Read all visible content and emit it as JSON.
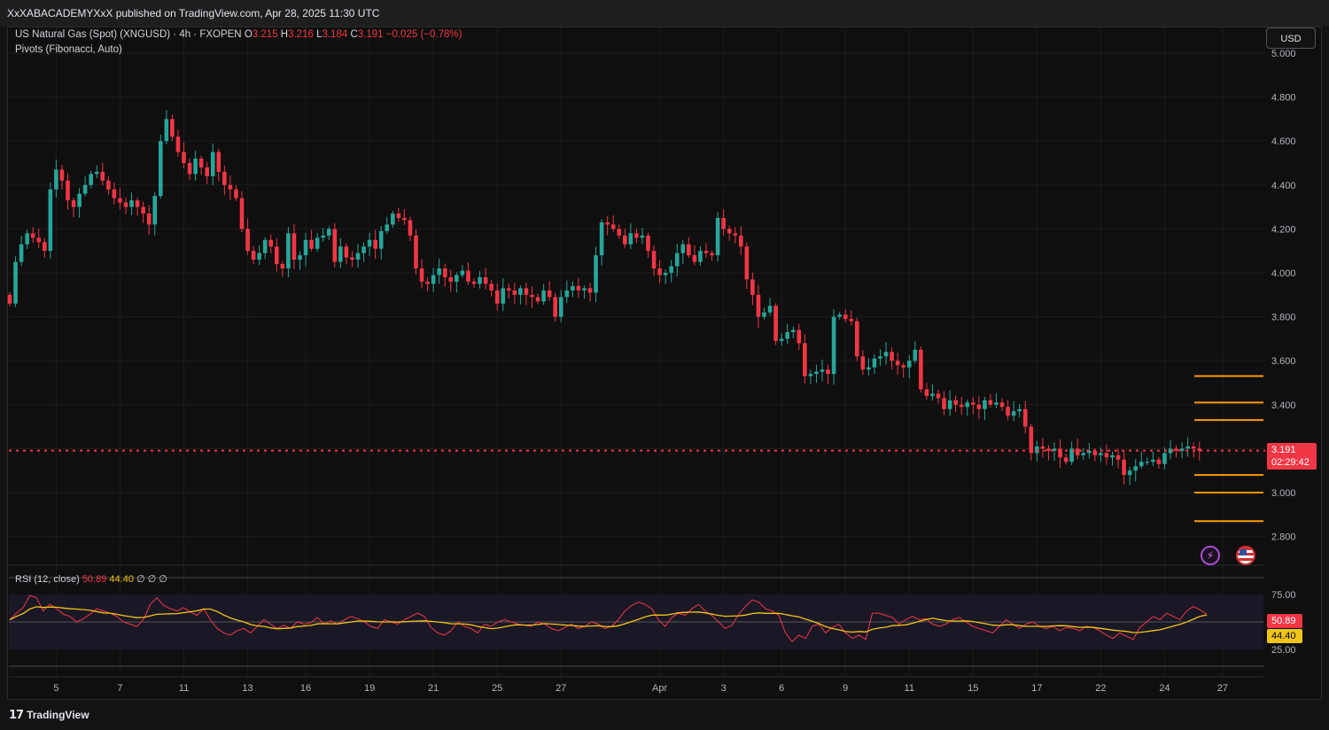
{
  "header": {
    "publisher_line": "XxXABACADEMYXxX published on TradingView.com, Apr 28, 2025 11:30 UTC"
  },
  "legend": {
    "symbol": "US Natural Gas (Spot) (XNGUSD) · 4h · FXOPEN",
    "open_label": "O",
    "open": "3.215",
    "high_label": "H",
    "high": "3.216",
    "low_label": "L",
    "low": "3.184",
    "close_label": "C",
    "close": "3.191",
    "change": "−0.025 (−0.78%)",
    "indicator": "Pivots (Fibonacci, Auto)"
  },
  "currency_button": "USD",
  "price_tag": {
    "price": "3.191",
    "countdown": "02:29:42"
  },
  "rsi": {
    "label": "RSI (12, close)",
    "value": "50.89",
    "ma_value": "44.40",
    "extras": "∅ ∅ ∅",
    "levels": [
      "75.00",
      "25.00"
    ]
  },
  "footer": {
    "brand": "TradingView"
  },
  "icons": {
    "bolt": "lightning-icon",
    "flag": "us-flag-icon",
    "logo": "tradingview-logo-icon"
  },
  "colors": {
    "up": "#26a69a",
    "down": "#f23645",
    "pivot": "#ff9800",
    "rsi": "#f23645",
    "rsi_ma": "#f0c419",
    "background": "#0f0f0f"
  },
  "chart_data": {
    "type": "candlestick",
    "symbol": "XNGUSD",
    "timeframe": "4h",
    "y_ticks": [
      "5.000",
      "4.800",
      "4.600",
      "4.400",
      "4.200",
      "4.000",
      "3.800",
      "3.600",
      "3.400",
      "3.200",
      "3.000",
      "2.800"
    ],
    "ylim": [
      2.72,
      5.02
    ],
    "x_labels": [
      {
        "label": "5",
        "i": 8
      },
      {
        "label": "7",
        "i": 19
      },
      {
        "label": "11",
        "i": 30
      },
      {
        "label": "13",
        "i": 41
      },
      {
        "label": "16",
        "i": 51
      },
      {
        "label": "19",
        "i": 62
      },
      {
        "label": "21",
        "i": 73
      },
      {
        "label": "25",
        "i": 84
      },
      {
        "label": "27",
        "i": 95
      },
      {
        "label": "Apr",
        "i": 112
      },
      {
        "label": "3",
        "i": 123
      },
      {
        "label": "6",
        "i": 133
      },
      {
        "label": "9",
        "i": 144
      },
      {
        "label": "11",
        "i": 155
      },
      {
        "label": "15",
        "i": 166
      },
      {
        "label": "17",
        "i": 177
      },
      {
        "label": "22",
        "i": 188
      },
      {
        "label": "24",
        "i": 199
      },
      {
        "label": "27",
        "i": 209
      }
    ],
    "last_price": 3.191,
    "pivots": [
      3.53,
      3.41,
      3.33,
      3.08,
      3.0,
      2.87
    ],
    "closes": [
      3.86,
      4.05,
      4.13,
      4.18,
      4.16,
      4.14,
      4.1,
      4.38,
      4.47,
      4.42,
      4.33,
      4.3,
      4.36,
      4.4,
      4.45,
      4.46,
      4.42,
      4.38,
      4.34,
      4.32,
      4.3,
      4.33,
      4.3,
      4.27,
      4.22,
      4.35,
      4.6,
      4.7,
      4.62,
      4.55,
      4.5,
      4.45,
      4.52,
      4.48,
      4.44,
      4.55,
      4.46,
      4.4,
      4.38,
      4.34,
      4.2,
      4.1,
      4.06,
      4.09,
      4.15,
      4.12,
      4.04,
      4.02,
      4.18,
      4.06,
      4.08,
      4.15,
      4.11,
      4.16,
      4.17,
      4.2,
      4.05,
      4.12,
      4.07,
      4.06,
      4.09,
      4.12,
      4.15,
      4.11,
      4.19,
      4.22,
      4.27,
      4.25,
      4.24,
      4.17,
      4.02,
      3.96,
      3.95,
      3.99,
      4.02,
      3.98,
      3.96,
      3.99,
      4.01,
      3.96,
      3.95,
      3.98,
      3.95,
      3.92,
      3.86,
      3.93,
      3.92,
      3.9,
      3.93,
      3.9,
      3.89,
      3.87,
      3.92,
      3.89,
      3.8,
      3.89,
      3.92,
      3.94,
      3.92,
      3.93,
      3.91,
      4.08,
      4.23,
      4.22,
      4.2,
      4.17,
      4.13,
      4.18,
      4.16,
      4.17,
      4.1,
      4.02,
      3.99,
      4.0,
      4.03,
      4.09,
      4.13,
      4.08,
      4.05,
      4.1,
      4.09,
      4.08,
      4.25,
      4.2,
      4.18,
      4.17,
      4.12,
      3.97,
      3.9,
      3.8,
      3.82,
      3.85,
      3.69,
      3.7,
      3.73,
      3.74,
      3.68,
      3.53,
      3.54,
      3.55,
      3.56,
      3.54,
      3.8,
      3.81,
      3.79,
      3.78,
      3.62,
      3.56,
      3.57,
      3.61,
      3.62,
      3.64,
      3.6,
      3.58,
      3.57,
      3.6,
      3.65,
      3.47,
      3.44,
      3.45,
      3.43,
      3.38,
      3.42,
      3.4,
      3.39,
      3.41,
      3.4,
      3.38,
      3.42,
      3.4,
      3.41,
      3.39,
      3.35,
      3.37,
      3.38,
      3.3,
      3.18,
      3.21,
      3.2,
      3.19,
      3.2,
      3.16,
      3.14,
      3.2,
      3.17,
      3.18,
      3.19,
      3.17,
      3.18,
      3.16,
      3.17,
      3.15,
      3.08,
      3.1,
      3.12,
      3.14,
      3.14,
      3.15,
      3.13,
      3.18,
      3.2,
      3.19,
      3.2,
      3.21,
      3.2,
      3.19
    ],
    "rsi_values": [
      52,
      58,
      63,
      74,
      72,
      60,
      66,
      62,
      57,
      55,
      50,
      53,
      57,
      62,
      60,
      58,
      55,
      50,
      48,
      46,
      52,
      66,
      72,
      65,
      62,
      60,
      63,
      59,
      56,
      62,
      52,
      44,
      40,
      38,
      42,
      44,
      40,
      46,
      52,
      48,
      44,
      47,
      44,
      50,
      48,
      49,
      54,
      48,
      51,
      48,
      52,
      55,
      53,
      50,
      46,
      44,
      52,
      50,
      48,
      52,
      55,
      58,
      55,
      45,
      40,
      38,
      42,
      50,
      46,
      44,
      40,
      48,
      46,
      50,
      52,
      50,
      48,
      47,
      46,
      50,
      48,
      44,
      42,
      45,
      48,
      44,
      46,
      50,
      48,
      44,
      46,
      52,
      60,
      65,
      68,
      66,
      62,
      52,
      46,
      54,
      58,
      56,
      62,
      66,
      60,
      56,
      50,
      44,
      47,
      57,
      64,
      70,
      68,
      62,
      60,
      56,
      40,
      32,
      38,
      35,
      46,
      48,
      40,
      45,
      48,
      40,
      35,
      38,
      34,
      58,
      58,
      56,
      54,
      48,
      52,
      55,
      52,
      53,
      48,
      46,
      48,
      52,
      54,
      50,
      46,
      44,
      42,
      40,
      46,
      52,
      48,
      44,
      48,
      50,
      46,
      44,
      46,
      42,
      45,
      44,
      42,
      46,
      45,
      42,
      38,
      35,
      40,
      37,
      34,
      45,
      50,
      55,
      52,
      58,
      55,
      52,
      60,
      64,
      61,
      57
    ]
  }
}
